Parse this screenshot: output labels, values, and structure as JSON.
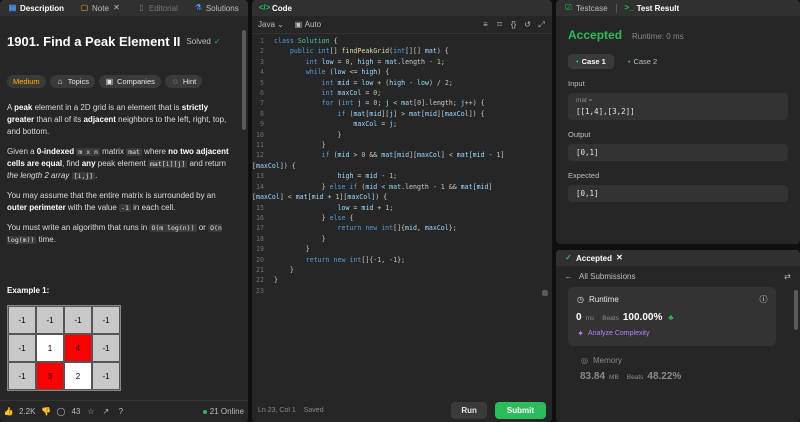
{
  "left": {
    "tabs": [
      {
        "label": "Description",
        "icon": "description-icon"
      },
      {
        "label": "Note",
        "icon": "note-icon"
      },
      {
        "label": "Editorial",
        "icon": "editorial-icon"
      },
      {
        "label": "Solutions",
        "icon": "solutions-icon"
      }
    ],
    "title": "1901. Find a Peak Element II",
    "solved_label": "Solved",
    "tags": [
      "Medium",
      "Topics",
      "Companies",
      "Hint"
    ],
    "p1": {
      "a": "A ",
      "b1": "peak",
      "c": " element in a 2D grid is an element that is ",
      "b2": "strictly greater",
      "d": " than all of its ",
      "b3": "adjacent",
      "e": " neighbors to the left, right, top, and bottom."
    },
    "p2": {
      "a": "Given a ",
      "b1": "0-indexed",
      "c1": "m x n",
      "d": " matrix ",
      "c2": "mat",
      "e": " where ",
      "b2": "no two adjacent cells are equal",
      "f": ", find ",
      "b3": "any",
      "g": " peak element ",
      "c3": "mat[i][j]",
      "h": " and return ",
      "i": "the length 2 array",
      "c4": "[i,j]",
      "j": "."
    },
    "p3": {
      "a": "You may assume that the entire matrix is surrounded by an ",
      "b1": "outer perimeter",
      "c": " with the value ",
      "c1": "-1",
      "d": " in each cell."
    },
    "p4": {
      "a": "You must write an algorithm that runs in ",
      "c1": "O(m log(n))",
      "b": " or ",
      "c2": "O(n log(m))",
      "c": " time."
    },
    "example_title": "Example 1:",
    "grid": [
      [
        "-1",
        "-1",
        "-1",
        "-1"
      ],
      [
        "-1",
        "1",
        "4",
        "-1"
      ],
      [
        "-1",
        "3",
        "2",
        "-1"
      ]
    ],
    "footer": {
      "likes": "2.2K",
      "comments": "43",
      "online": "21 Online"
    }
  },
  "editor": {
    "tab_label": "Code",
    "language": "Java",
    "mode": "Auto",
    "status": "Ln 23, Col 1",
    "saved": "Saved",
    "run_label": "Run",
    "submit_label": "Submit"
  },
  "result": {
    "tabs": [
      {
        "label": "Testcase"
      },
      {
        "label": "Test Result"
      }
    ],
    "status": "Accepted",
    "runtime": "Runtime: 0 ms",
    "cases": [
      "Case 1",
      "Case 2"
    ],
    "input_label": "Input",
    "input_var": "mat =",
    "input_value": "[[1,4],[3,2]]",
    "output_label": "Output",
    "output_value": "[0,1]",
    "expected_label": "Expected",
    "expected_value": "[0,1]"
  },
  "submission": {
    "tab_label": "Accepted",
    "back_label": "All Submissions",
    "runtime_label": "Runtime",
    "runtime_value": "0",
    "runtime_unit": "ms",
    "beats_label": "Beats",
    "runtime_beats": "100.00%",
    "analyze_label": "Analyze Complexity",
    "memory_label": "Memory",
    "memory_value": "83.84",
    "memory_unit": "MB",
    "memory_beats": "48.22%"
  },
  "colors": {
    "accent_green": "#2cbb5d",
    "medium": "#ffb700",
    "peak_red": "#ff0000"
  }
}
